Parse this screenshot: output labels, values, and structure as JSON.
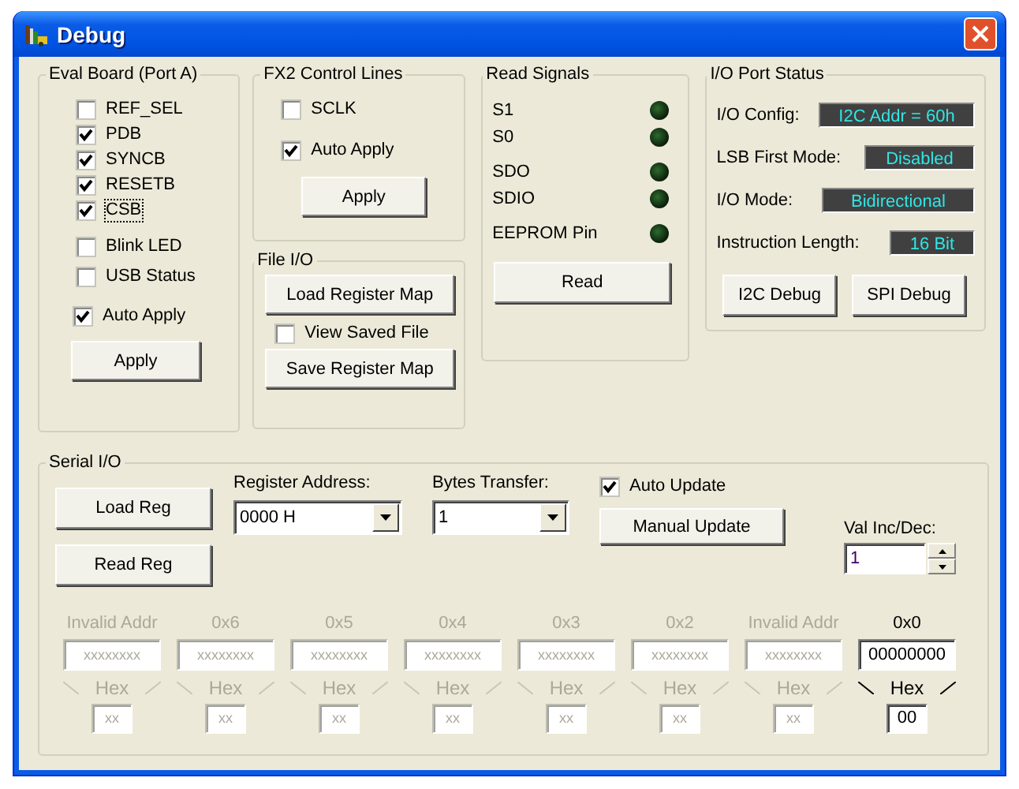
{
  "window": {
    "title": "Debug"
  },
  "eval_board": {
    "title": "Eval Board (Port A)",
    "signals": [
      {
        "label": "REF_SEL",
        "checked": false,
        "focused": false
      },
      {
        "label": "PDB",
        "checked": true,
        "focused": false
      },
      {
        "label": "SYNCB",
        "checked": true,
        "focused": false
      },
      {
        "label": "RESETB",
        "checked": true,
        "focused": false
      },
      {
        "label": "CSB",
        "checked": true,
        "focused": true
      }
    ],
    "options": [
      {
        "label": "Blink LED",
        "checked": false
      },
      {
        "label": "USB Status",
        "checked": false
      }
    ],
    "auto_apply": {
      "label": "Auto Apply",
      "checked": true
    },
    "button": "Apply"
  },
  "fx2_control_lines": {
    "title": "FX2 Control Lines",
    "sclk": {
      "label": "SCLK",
      "checked": false
    },
    "auto_apply": {
      "label": "Auto Apply",
      "checked": true
    },
    "button": "Apply"
  },
  "file_io": {
    "title": "File I/O",
    "load_button": "Load Register Map",
    "view_saved": {
      "label": "View Saved File",
      "checked": false
    },
    "save_button": "Save Register Map"
  },
  "read_signals": {
    "title": "Read Signals",
    "groups": [
      [
        {
          "label": "S1",
          "on": false
        },
        {
          "label": "S0",
          "on": false
        }
      ],
      [
        {
          "label": "SDO",
          "on": false
        },
        {
          "label": "SDIO",
          "on": false
        }
      ],
      [
        {
          "label": "EEPROM Pin",
          "on": false
        }
      ]
    ],
    "button": "Read"
  },
  "io_port_status": {
    "title": "I/O Port Status",
    "fields": [
      {
        "label": "I/O Config:",
        "value": "I2C Addr = 60h"
      },
      {
        "label": "LSB First Mode:",
        "value": "Disabled"
      },
      {
        "label": "I/O Mode:",
        "value": "Bidirectional"
      },
      {
        "label": "Instruction Length:",
        "value": "16 Bit"
      }
    ],
    "buttons": [
      "I2C Debug",
      "SPI Debug"
    ]
  },
  "serial_io": {
    "title": "Serial I/O",
    "buttons": [
      "Load Reg",
      "Read Reg"
    ],
    "register_address": {
      "label": "Register Address:",
      "value": "0000 H"
    },
    "bytes_transfer": {
      "label": "Bytes Transfer:",
      "value": "1"
    },
    "auto_update": {
      "label": "Auto Update",
      "checked": true
    },
    "manual_update": "Manual Update",
    "val_inc_dec": {
      "label": "Val Inc/Dec:",
      "value": "1"
    },
    "registers": [
      {
        "label": "Invalid Addr",
        "value": "xxxxxxxx",
        "hex_label": "Hex",
        "hex_value": "xx",
        "disabled": true
      },
      {
        "label": "0x6",
        "value": "xxxxxxxx",
        "hex_label": "Hex",
        "hex_value": "xx",
        "disabled": true
      },
      {
        "label": "0x5",
        "value": "xxxxxxxx",
        "hex_label": "Hex",
        "hex_value": "xx",
        "disabled": true
      },
      {
        "label": "0x4",
        "value": "xxxxxxxx",
        "hex_label": "Hex",
        "hex_value": "xx",
        "disabled": true
      },
      {
        "label": "0x3",
        "value": "xxxxxxxx",
        "hex_label": "Hex",
        "hex_value": "xx",
        "disabled": true
      },
      {
        "label": "0x2",
        "value": "xxxxxxxx",
        "hex_label": "Hex",
        "hex_value": "xx",
        "disabled": true
      },
      {
        "label": "Invalid Addr",
        "value": "xxxxxxxx",
        "hex_label": "Hex",
        "hex_value": "xx",
        "disabled": true
      },
      {
        "label": "0x0",
        "value": "00000000",
        "hex_label": "Hex",
        "hex_value": "00",
        "disabled": false
      }
    ]
  }
}
